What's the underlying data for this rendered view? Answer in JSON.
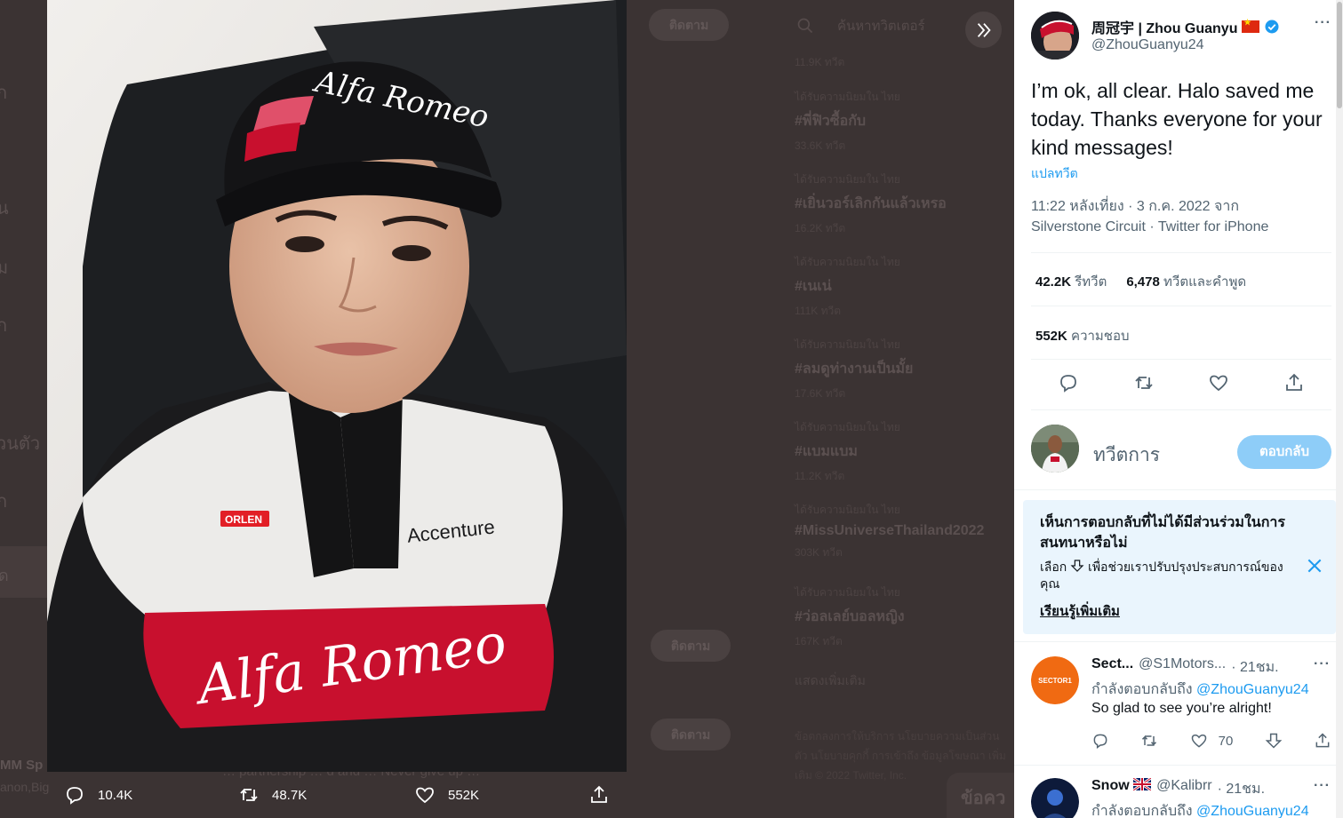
{
  "background": {
    "left_fragments": [
      "ก",
      "น",
      "ม",
      "ก",
      "วนตัว",
      "ก"
    ],
    "left_highlight_label": "ด",
    "mm_title": "MM Sp",
    "mm_sub": "anon,Big",
    "follow_label": "ติดตาม",
    "search_placeholder": "ค้นหาทวิตเตอร์",
    "top_count": "11.9K ทวีต",
    "trends": [
      {
        "context": "ได้รับความนิยมใน ไทย",
        "tag": "#พี่ฟิวซื้อกับ",
        "count": "33.6K ทวีต"
      },
      {
        "context": "ได้รับความนิยมใน ไทย",
        "tag": "#เยิ่นวอร์เลิกกันแล้วเหรอ",
        "count": "16.2K ทวีต"
      },
      {
        "context": "ได้รับความนิยมใน ไทย",
        "tag": "#เนเน่",
        "count": "111K ทวีต"
      },
      {
        "context": "ได้รับความนิยมใน ไทย",
        "tag": "#ลมดูท่างานเป็นมั้ย",
        "count": "17.6K ทวีต"
      },
      {
        "context": "ได้รับความนิยมใน ไทย",
        "tag": "#แบมแบม",
        "count": "11.2K ทวีต"
      },
      {
        "context": "ได้รับความนิยมใน ไทย",
        "tag": "#MissUniverseThailand2022",
        "count": "303K ทวีต"
      },
      {
        "context": "ได้รับความนิยมใน ไทย",
        "tag": "#ว่อลเลย์บอลหญิง",
        "count": "167K ทวีต"
      }
    ],
    "show_more": "แสดงเพิ่มเติม",
    "footer": "ข้อตกลงการให้บริการ   นโยบายความเป็นส่วนตัว   นโยบายคุกกี้   การเข้าถึง   ข้อมูลโฆษณา   เพิ่มเติม   © 2022 Twitter, Inc.",
    "tweet_fragment": "… partnership … d and … Never give up …",
    "messages_label": "ข้อคว"
  },
  "media_actions": {
    "replies": "10.4K",
    "retweets": "48.7K",
    "likes": "552K"
  },
  "tweet": {
    "author_name": "周冠宇 | Zhou Guanyu",
    "author_handle": "@ZhouGuanyu24",
    "text": "I’m ok, all clear. Halo saved me today. Thanks everyone for your kind messages!",
    "translate": "แปลทวีต",
    "meta_line1": "11:22 หลังเที่ยง · 3 ก.ค. 2022 จาก",
    "meta_line2": "Silverstone Circuit · Twitter for iPhone",
    "retweets_count": "42.2K",
    "retweets_label": "รีทวีต",
    "quotes_count": "6,478",
    "quotes_label": "ทวีตและคำพูด",
    "likes_count": "552K",
    "likes_label": "ความชอบ"
  },
  "reply_box": {
    "placeholder": "ทวีตการ",
    "button": "ตอบกลับ"
  },
  "notice": {
    "title": "เห็นการตอบกลับที่ไม่ได้มีส่วนร่วมในการสนทนาหรือไม่",
    "body_pre": "เลือก",
    "body_post": "เพื่อช่วยเราปรับปรุงประสบการณ์ของคุณ",
    "link": "เรียนรู้เพิ่มเติม"
  },
  "replies": [
    {
      "name": "Sect...",
      "handle": "@S1Motors...",
      "time": "· 21ชม.",
      "replying_to_label": "กำลังตอบกลับถึง",
      "replying_to": "@ZhouGuanyu24",
      "text": "So glad to see you’re alright!",
      "likes": "70",
      "avatar_text": "SECTOR1"
    },
    {
      "name": "Snow",
      "handle": "@Kalibrr",
      "time": "· 21ชม.",
      "replying_to_label": "กำลังตอบกลับถึง",
      "replying_to": "@ZhouGuanyu24",
      "text": "",
      "likes": ""
    }
  ],
  "colors": {
    "accent": "#1d9bf0",
    "reply_button_disabled": "#8ecdf8",
    "notice_bg": "#eaf5fd",
    "overlay": "#3b3333"
  }
}
